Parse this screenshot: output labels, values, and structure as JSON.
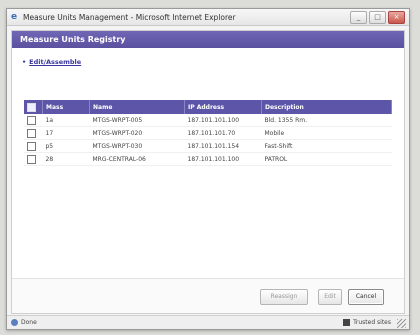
{
  "window": {
    "title": "Measure Units Management - Microsoft Internet Explorer",
    "controls": [
      "_",
      "□",
      "×"
    ]
  },
  "page": {
    "header": "Measure Units Registry",
    "link_text": "Edit/Assemble"
  },
  "table": {
    "columns": [
      "Mass",
      "Name",
      "IP Address",
      "Description"
    ],
    "rows": [
      {
        "mass": "1a",
        "name": "MTGS-WRPT-005",
        "ip": "187.101.101.100",
        "desc": "Bld. 1355 Rm."
      },
      {
        "mass": "17",
        "name": "MTGS-WRPT-020",
        "ip": "187.101.101.70",
        "desc": "Mobile"
      },
      {
        "mass": "p5",
        "name": "MTGS-WRPT-030",
        "ip": "187.101.101.154",
        "desc": "Fast-Shift"
      },
      {
        "mass": "28",
        "name": "MRG-CENTRAL-06",
        "ip": "187.101.101.100",
        "desc": "PATROL"
      }
    ]
  },
  "buttons": {
    "first": "Reassign",
    "second": "Edit",
    "cancel": "Cancel"
  },
  "status": {
    "left": "Done",
    "right": "Trusted sites"
  }
}
